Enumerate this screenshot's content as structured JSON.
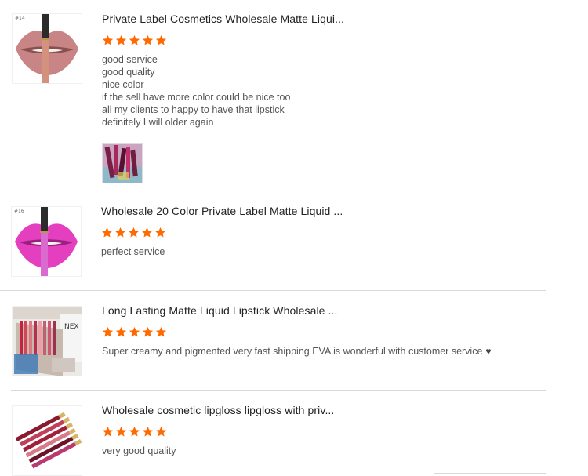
{
  "reviews": [
    {
      "product_title": "Private Label Cosmetics Wholesale Matte Liqui...",
      "thumb_tag": "#14",
      "rating": 5,
      "lines": [
        "good service",
        "good quality",
        "nice color",
        "if the sell have more color could be nice too",
        "all my clients to happy to have that lipstick",
        "definitely I will older again"
      ],
      "lip_color": "#c98585",
      "tube_color": "#d4927e"
    },
    {
      "product_title": "Wholesale 20 Color Private Label Matte Liquid ...",
      "thumb_tag": "#16",
      "rating": 5,
      "lines": [
        "perfect service"
      ],
      "lip_color": "#e33fbf",
      "tube_color": "#d86ad0"
    },
    {
      "product_title": "Long Lasting Matte Liquid Lipstick Wholesale ...",
      "rating": 5,
      "lines": [
        "Super creamy and pigmented very fast shipping EVA is wonderful with customer service"
      ],
      "heart": "♥"
    },
    {
      "product_title": "Wholesale cosmetic lipgloss lipgloss with priv...",
      "rating": 5,
      "lines": [
        "very good quality"
      ]
    }
  ],
  "colors": {
    "star": "#ff6a00",
    "divider": "#d9d9d9"
  }
}
